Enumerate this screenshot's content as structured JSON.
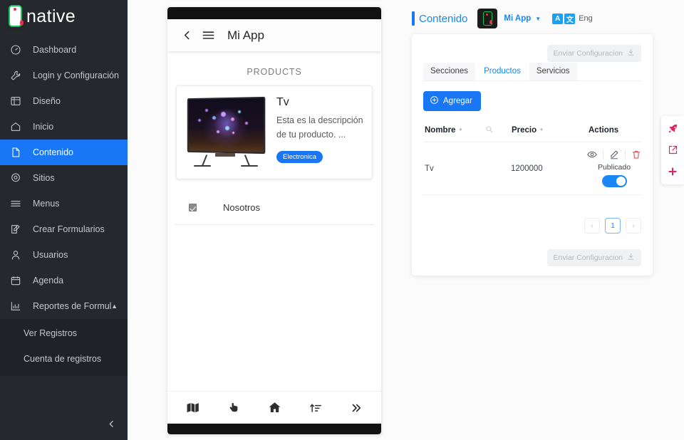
{
  "sidebar": {
    "logo_text": "native",
    "items": [
      {
        "label": "Dashboard",
        "icon": "speedometer-icon",
        "active": false
      },
      {
        "label": "Login y Configuración",
        "icon": "wrench-icon",
        "active": false
      },
      {
        "label": "Diseño",
        "icon": "layout-icon",
        "active": false
      },
      {
        "label": "Inicio",
        "icon": "home-icon",
        "active": false
      },
      {
        "label": "Contenido",
        "icon": "document-icon",
        "active": true
      },
      {
        "label": "Sitios",
        "icon": "location-pin-icon",
        "active": false
      },
      {
        "label": "Menus",
        "icon": "hamburger-icon",
        "active": false
      },
      {
        "label": "Crear Formularios",
        "icon": "edit-square-icon",
        "active": false
      },
      {
        "label": "Usuarios",
        "icon": "user-icon",
        "active": false
      },
      {
        "label": "Agenda",
        "icon": "calendar-icon",
        "active": false
      },
      {
        "label": "Reportes de Formular...",
        "icon": "bar-chart-icon",
        "active": false,
        "expanded": true
      }
    ],
    "subitems": [
      {
        "label": "Ver Registros"
      },
      {
        "label": "Cuenta de registros"
      }
    ],
    "collapse_icon": "chevron-left-icon"
  },
  "phone_preview": {
    "back_icon": "chevron-left-icon",
    "menu_icon": "hamburger-icon",
    "app_title": "Mi App",
    "section_label": "PRODUCTS",
    "product": {
      "name": "Tv",
      "description": "Esta es la descripción de tu producto. ...",
      "tag": "Electronica",
      "image_alt": "curved-tv-image"
    },
    "list_row": {
      "label": "Nosotros",
      "checked": true
    },
    "bottom_nav": [
      {
        "icon": "map-icon"
      },
      {
        "icon": "pointing-hand-icon"
      },
      {
        "icon": "home-icon"
      },
      {
        "icon": "sort-icon"
      },
      {
        "icon": "double-chevron-right-icon"
      }
    ]
  },
  "header": {
    "title": "Contenido",
    "app_name": "Mi App",
    "app_caret_icon": "caret-down-icon",
    "lang_icon_a": "A",
    "lang_icon_b": "文",
    "lang_label": "Eng"
  },
  "panel": {
    "send_config_top": "Enviar Configuracion",
    "send_config_bottom": "Enviar Configuracion",
    "send_config_icon": "download-icon",
    "tabs": [
      {
        "label": "Secciones",
        "active": false
      },
      {
        "label": "Productos",
        "active": true
      },
      {
        "label": "Servicios",
        "active": false
      }
    ],
    "add_button": "Agregar",
    "add_button_icon": "plus-circle-icon",
    "table": {
      "columns": [
        "Nombre",
        "Precio",
        "Actions"
      ],
      "sort_icon": "sort-arrows-icon",
      "search_icon": "search-icon",
      "rows": [
        {
          "nombre": "Tv",
          "precio": "1200000",
          "actions": {
            "view_icon": "eye-icon",
            "edit_icon": "pencil-icon",
            "delete_icon": "trash-icon",
            "publish_label": "Publicado",
            "published": true
          }
        }
      ]
    },
    "pagination": {
      "prev_icon": "chevron-left-icon",
      "next_icon": "chevron-right-icon",
      "pages": [
        "1"
      ],
      "current": "1"
    }
  },
  "fab_rail": [
    {
      "icon": "rocket-icon"
    },
    {
      "icon": "share-icon"
    },
    {
      "icon": "plus-icon"
    }
  ],
  "colors": {
    "accent_blue": "#1976f5",
    "link_blue": "#1a87f0",
    "sidebar_bg": "#25282c",
    "logo_green": "#19c25a",
    "logo_red": "#e5304b",
    "fab_red": "#e0245e",
    "danger_red": "#ef3b3b"
  }
}
